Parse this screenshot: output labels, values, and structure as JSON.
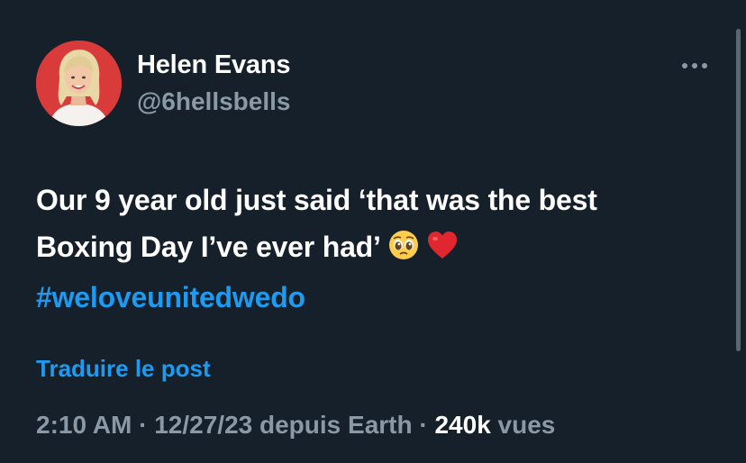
{
  "author": {
    "display_name": "Helen Evans",
    "handle": "@6hellsbells",
    "avatar_bg": "#d93b3b"
  },
  "tweet": {
    "line1": "Our 9 year old just said ‘that was the best",
    "line2": "Boxing Day I’ve ever had’",
    "emojis": [
      "pleading-face",
      "red-heart"
    ],
    "hashtag": "#weloveunitedwedo"
  },
  "actions": {
    "translate": "Traduire le post",
    "more_icon": "more-horizontal-icon"
  },
  "meta": {
    "time": "2:10 AM",
    "sep1": " · ",
    "date": "12/27/23",
    "source": " depuis Earth",
    "sep2": " · ",
    "views_count": "240k",
    "views_label": " vues"
  },
  "colors": {
    "background": "#15202b",
    "text": "#ffffff",
    "secondary": "#8b98a5",
    "link": "#1d9bf0"
  }
}
